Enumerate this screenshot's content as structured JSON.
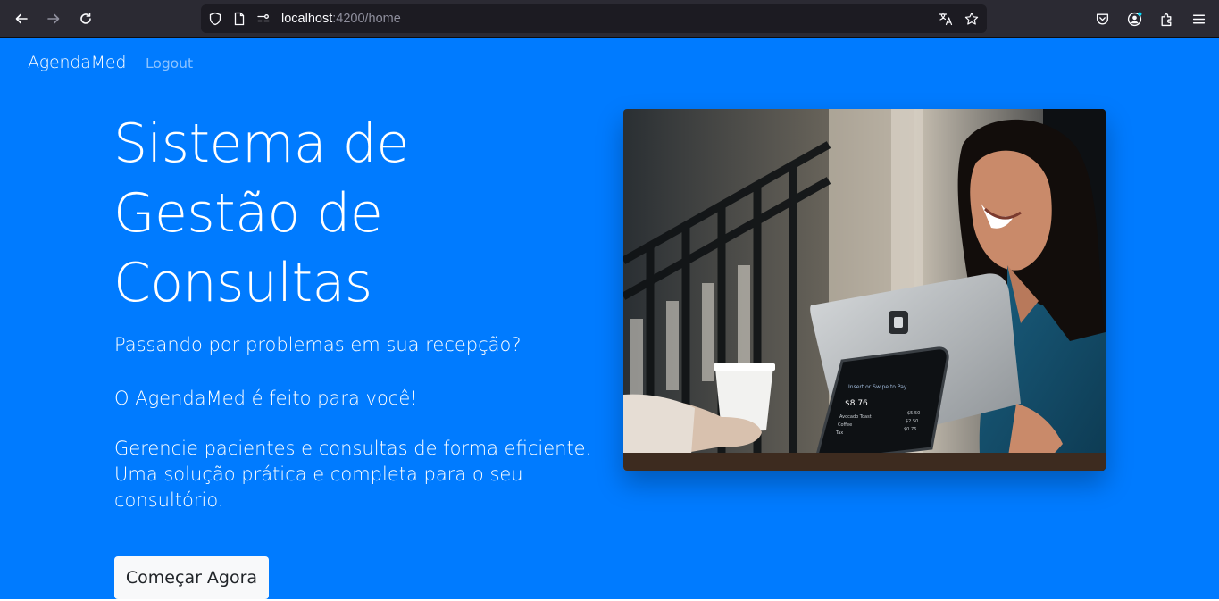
{
  "browser": {
    "url_host": "localhost",
    "url_path": ":4200/home"
  },
  "navbar": {
    "brand": "AgendaMed",
    "logout": "Logout"
  },
  "hero": {
    "title": "Sistema de Gestão de Consultas",
    "line1": "Passando por problemas em sua recepção?",
    "line2": "O AgendaMed é feito para você!",
    "line3": "Gerencie pacientes e consultas de forma eficiente. Uma solução prática e completa para o seu consultório.",
    "cta": "Começar Agora"
  },
  "image": {
    "screen_amount": "$8.76",
    "screen_header": "Insert or Swipe to Pay",
    "items": [
      {
        "name": "Avocado Toast",
        "price": "$5.50"
      },
      {
        "name": "Coffee",
        "price": "$2.50"
      },
      {
        "name": "Tax",
        "price": "$0.76"
      }
    ]
  },
  "colors": {
    "page_bg": "#007bff",
    "chrome_bg": "#2b2a33",
    "button_bg": "#f8f9fa"
  }
}
